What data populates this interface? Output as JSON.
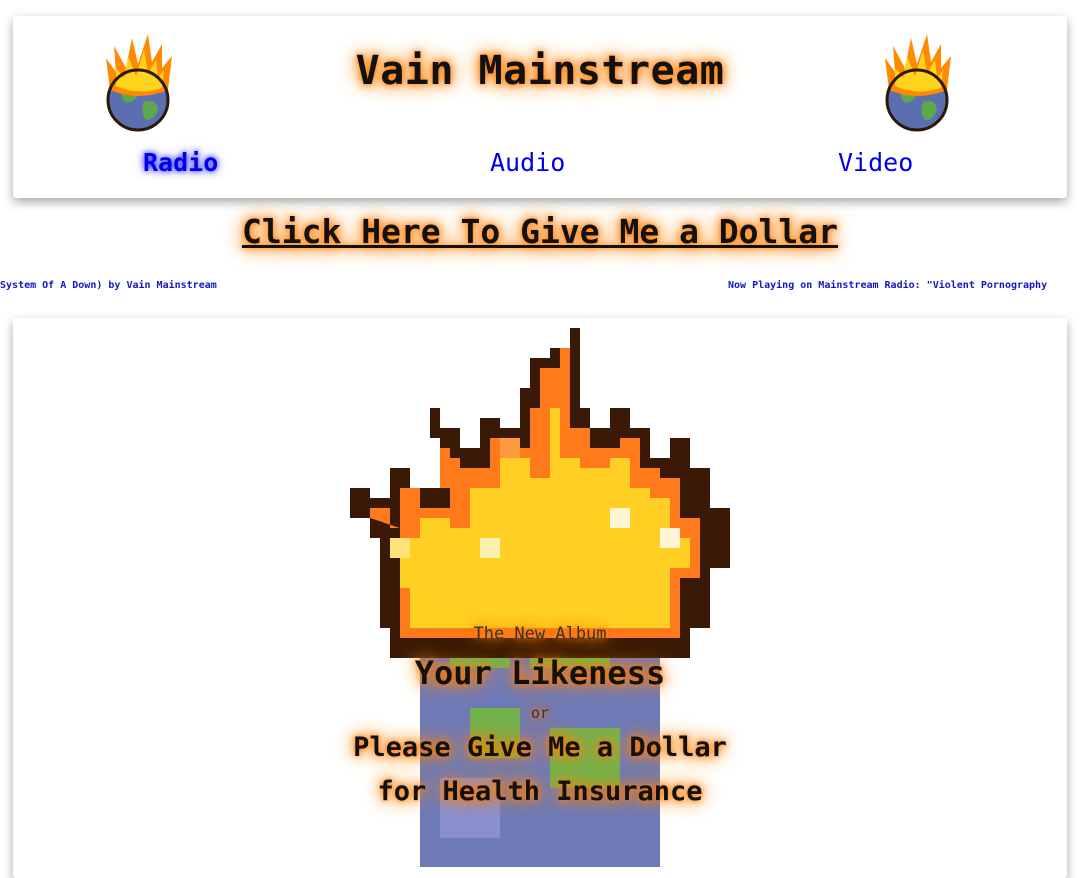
{
  "header": {
    "title": "Vain Mainstream",
    "nav": [
      {
        "label": "Radio",
        "active": true
      },
      {
        "label": "Audio",
        "active": false
      },
      {
        "label": "Video",
        "active": false
      }
    ],
    "logo_icon": "burning-globe-icon"
  },
  "donate": {
    "label": "Click Here To Give Me a Dollar"
  },
  "ticker": {
    "left_text": "(System Of A Down) by Vain Mainstream",
    "right_text": "Now Playing on Mainstream Radio: \"Violent Pornography"
  },
  "promo": {
    "kicker": "The New Album",
    "title": "Your Likeness",
    "or": "or",
    "subtitle_line1": "Please Give Me a Dollar",
    "subtitle_line2": "for Health Insurance",
    "art_icon": "burning-globe-icon"
  },
  "colors": {
    "link": "#0000ee",
    "glow": "#ff7a00",
    "ticker": "#1515c8"
  }
}
